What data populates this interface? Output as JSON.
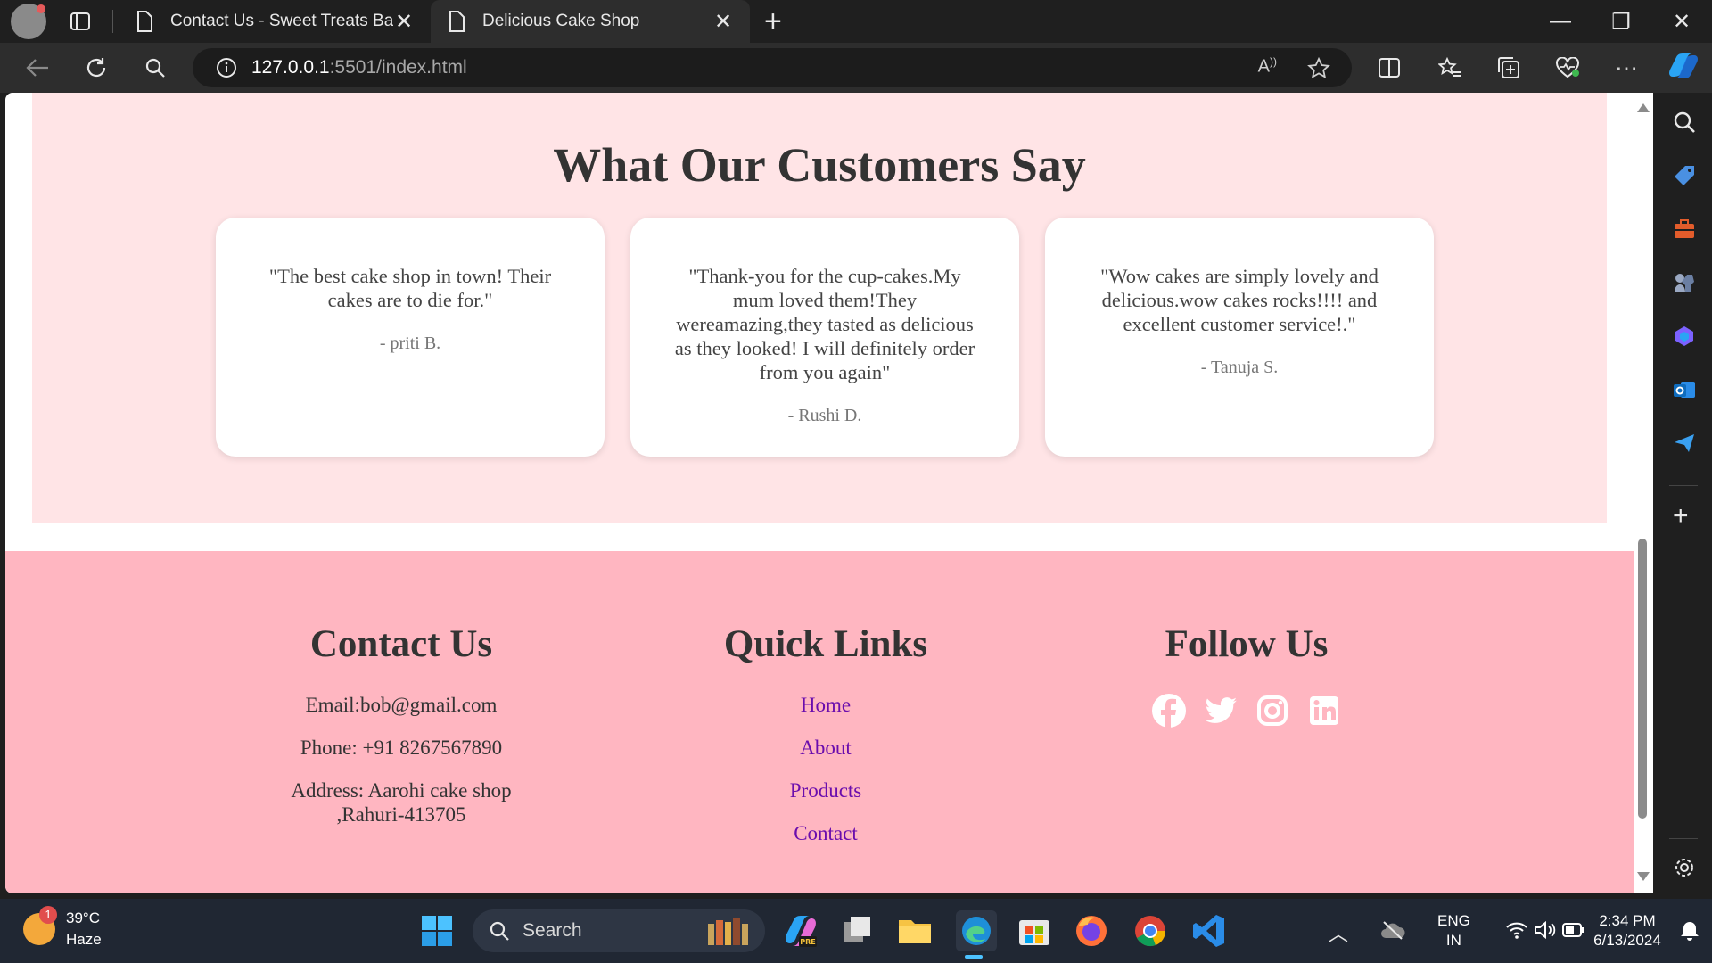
{
  "browser": {
    "tabs": [
      {
        "title": "Contact Us - Sweet Treats Bakery",
        "active": false
      },
      {
        "title": "Delicious Cake Shop",
        "active": true
      }
    ],
    "url_host": "127.0.0.1",
    "url_rest": ":5501/index.html"
  },
  "testimonials": {
    "heading": "What Our Customers Say",
    "cards": [
      {
        "quote": "\"The best cake shop in town! Their cakes are to die for.\"",
        "author": "- priti B."
      },
      {
        "quote": "\"Thank-you for the cup-cakes.My mum loved them!They wereamazing,they tasted as delicious as they looked! I will definitely order from you again\"",
        "author": "- Rushi D."
      },
      {
        "quote": "\"Wow cakes are simply lovely and delicious.wow cakes rocks!!!! and excellent customer service!.\"",
        "author": "- Tanuja S."
      }
    ]
  },
  "footer": {
    "contact": {
      "heading": "Contact Us",
      "email": "Email:bob@gmail.com",
      "phone": "Phone: +91 8267567890",
      "address": "Address: Aarohi cake shop ,Rahuri-413705"
    },
    "links": {
      "heading": "Quick Links",
      "items": [
        "Home",
        "About",
        "Products",
        "Contact"
      ]
    },
    "follow": {
      "heading": "Follow Us",
      "icons": [
        "facebook-icon",
        "twitter-icon",
        "instagram-icon",
        "linkedin-icon"
      ]
    }
  },
  "taskbar": {
    "weather_temp": "39°C",
    "weather_desc": "Haze",
    "weather_badge": "1",
    "search_label": "Search",
    "lang_1": "ENG",
    "lang_2": "IN",
    "time": "2:34 PM",
    "date": "6/13/2024"
  },
  "colors": {
    "testimonial_bg": "#ffe4e6",
    "footer_bg": "#ffb6c1",
    "link": "#6a0dad"
  }
}
